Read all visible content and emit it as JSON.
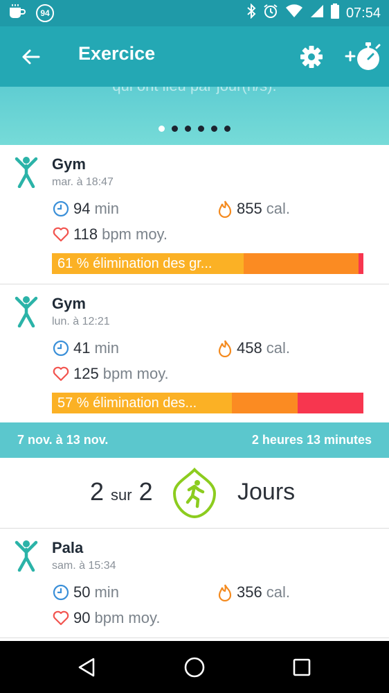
{
  "status_bar": {
    "notification_badge": "94",
    "time": "07:54"
  },
  "app_bar": {
    "title": "Exercice"
  },
  "hero": {
    "partial_text": "qui ont lieu par jour(h/s).",
    "page_count": 6,
    "active_index": 0
  },
  "activities": [
    {
      "name": "Gym",
      "when": "mar. à 18:47",
      "duration_value": "94",
      "duration_unit": "min",
      "calories_value": "855",
      "calories_unit": "cal.",
      "hr_value": "118",
      "hr_unit": "bpm moy.",
      "zone_label": "61 % élimination des gr...",
      "zones": [
        {
          "color": "#fbb125",
          "fraction": 0.615
        },
        {
          "color": "#fb8b22",
          "fraction": 0.37
        },
        {
          "color": "#f7364f",
          "fraction": 0.015
        }
      ]
    },
    {
      "name": "Gym",
      "when": "lun. à 12:21",
      "duration_value": "41",
      "duration_unit": "min",
      "calories_value": "458",
      "calories_unit": "cal.",
      "hr_value": "125",
      "hr_unit": "bpm moy.",
      "zone_label": "57 % élimination des...",
      "zones": [
        {
          "color": "#fbb125",
          "fraction": 0.578
        },
        {
          "color": "#fb8b22",
          "fraction": 0.211
        },
        {
          "color": "#f7364f",
          "fraction": 0.211
        }
      ]
    },
    {
      "name": "Pala",
      "when": "sam. à 15:34",
      "duration_value": "50",
      "duration_unit": "min",
      "calories_value": "356",
      "calories_unit": "cal.",
      "hr_value": "90",
      "hr_unit": "bpm moy."
    }
  ],
  "week": {
    "range": "7 nov. à 13 nov.",
    "total": "2 heures 13 minutes"
  },
  "summary": {
    "done": "2",
    "sep": "sur",
    "goal": "2",
    "label": "Jours"
  },
  "colors": {
    "accent": "#24a8b4",
    "status_bar": "#1f9aa8",
    "week_band": "#5bc7cd",
    "figure_icon": "#2bb3a8",
    "badge": "#8ccc1f"
  }
}
